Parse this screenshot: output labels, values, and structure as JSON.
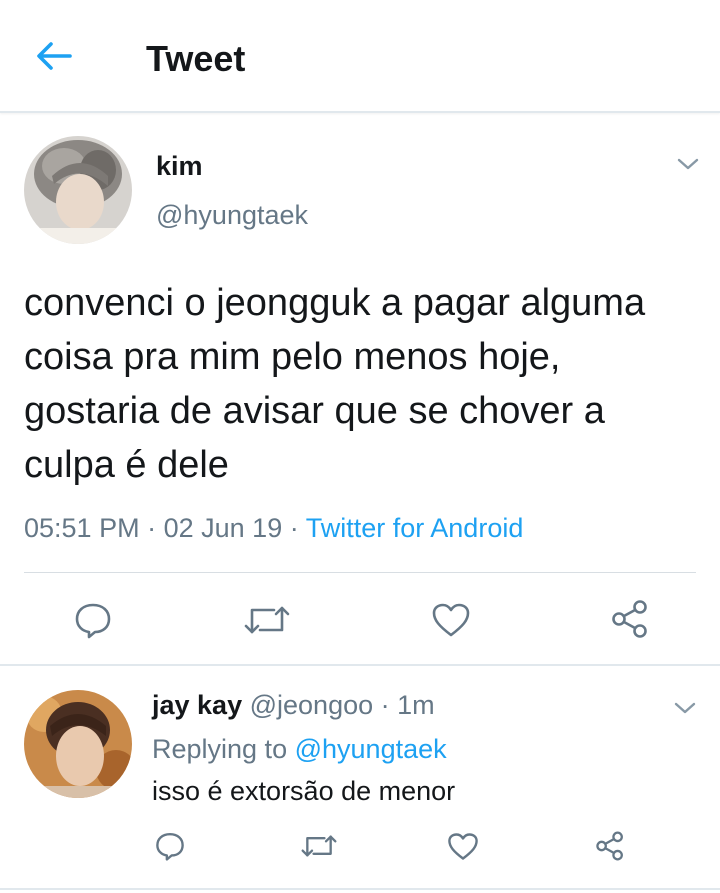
{
  "header": {
    "title": "Tweet",
    "back_icon": "arrow-left-icon",
    "accent": "#1da1f2"
  },
  "tweet": {
    "display_name": "kim",
    "handle": "@hyungtaek",
    "text": "convenci o jeongguk a pagar alguma coisa pra mim pelo menos hoje, gostaria de avisar que se chover a culpa é dele",
    "time": "05:51 PM",
    "sep1": "·",
    "date": "02 Jun 19",
    "sep2": "·",
    "source": "Twitter for Android",
    "actions": [
      "reply-icon",
      "retweet-icon",
      "like-icon",
      "share-icon"
    ]
  },
  "reply": {
    "display_name": "jay kay",
    "handle": "@jeongoo",
    "sep": "·",
    "time_ago": "1m",
    "replying_prefix": "Replying to",
    "replying_handle": "@hyungtaek",
    "text": "isso é extorsão de menor",
    "actions": [
      "reply-icon",
      "retweet-icon",
      "like-icon",
      "share-icon"
    ]
  },
  "colors": {
    "text": "#14171a",
    "secondary": "#657786",
    "link": "#1da1f2",
    "icon": "#657786",
    "divider": "#e1e8ed"
  }
}
